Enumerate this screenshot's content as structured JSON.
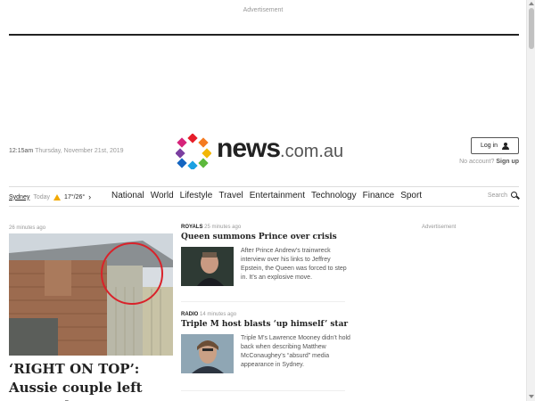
{
  "ads": {
    "top_label": "Advertisement",
    "side_label": "Advertisement"
  },
  "header": {
    "time": "12:15am",
    "date": "Thursday, November 21st, 2019",
    "logo_main": "news",
    "logo_suffix": ".com.au",
    "login_label": "Log in",
    "no_account": "No account?",
    "signup_label": "Sign up"
  },
  "weather": {
    "city": "Sydney",
    "day": "Today",
    "temps": "17°/26°",
    "icon": "sun-icon"
  },
  "nav": {
    "items": [
      "National",
      "World",
      "Lifestyle",
      "Travel",
      "Entertainment",
      "Technology",
      "Finance",
      "Sport"
    ]
  },
  "search": {
    "label": "Search"
  },
  "lead": {
    "time": "26 minutes ago",
    "headline": "‘RIGHT ON TOP’: Aussie couple left stunned"
  },
  "stories": [
    {
      "category": "ROYALS",
      "time": "25 minutes ago",
      "headline": "Queen summons Prince over crisis",
      "blurb": "After Prince Andrew’s trainwreck interview over his links to Jeffrey Epstein, the Queen was forced to step in. It’s an explosive move."
    },
    {
      "category": "RADIO",
      "time": "14 minutes ago",
      "headline": "Triple M host blasts ‘up himself’ star",
      "blurb": "Triple M’s Lawrence Mooney didn’t hold back when describing Matthew McConaughey’s “absurd” media appearance in Sydney."
    }
  ],
  "colors": {
    "accent": "#222222",
    "muted": "#999999",
    "highlight_ring": "#d9222a"
  }
}
